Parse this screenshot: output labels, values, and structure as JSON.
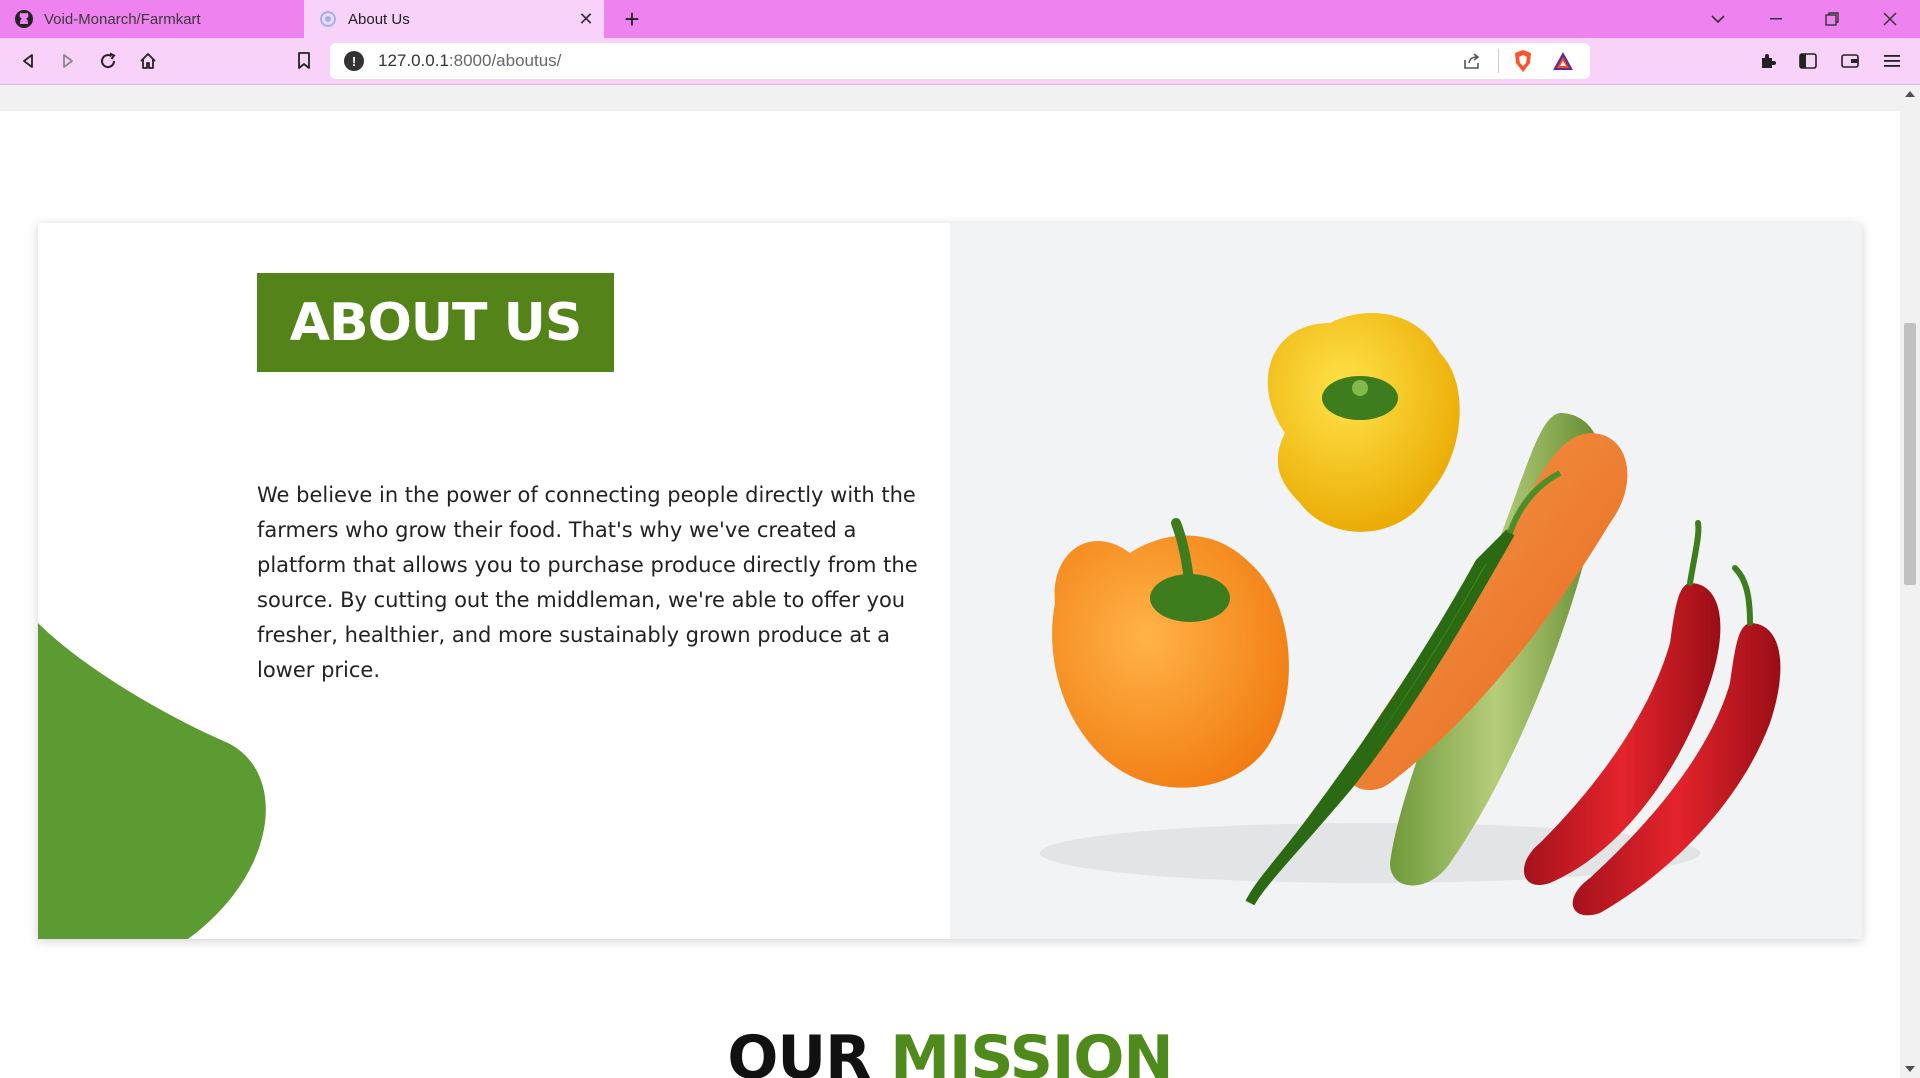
{
  "browser": {
    "tabs": [
      {
        "title": "Void-Monarch/Farmkart",
        "active": false,
        "icon": "github-icon"
      },
      {
        "title": "About Us",
        "active": true,
        "icon": "site-favicon-icon"
      }
    ],
    "url_host": "127.0.0.1",
    "url_rest": ":8000/aboutus/",
    "accent": "#ee82ee"
  },
  "page": {
    "about_title": "ABOUT US",
    "about_text": "We believe in the power of connecting people directly with the farmers who grow their food. That's why we've created a platform that allows you to purchase produce directly from the source. By cutting out the middleman, we're able to offer you fresher, healthier, and more sustainably grown produce at a lower price.",
    "mission_word1": "OUR",
    "mission_word2": "MISSION",
    "brand_green": "#548419",
    "image_subject": "vegetables-image"
  }
}
